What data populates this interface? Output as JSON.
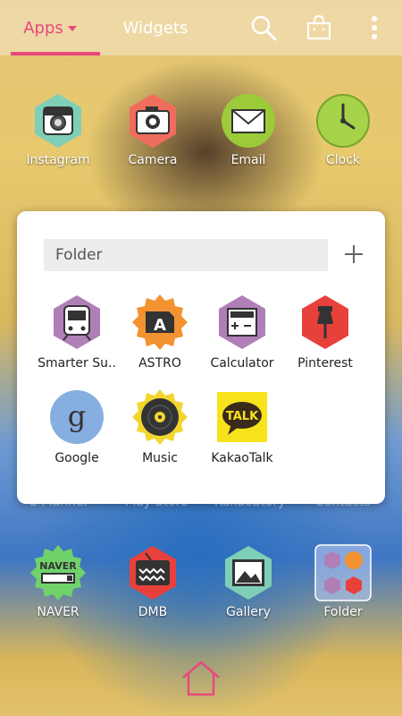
{
  "header": {
    "tabs": [
      {
        "label": "Apps",
        "active": true
      },
      {
        "label": "Widgets",
        "active": false
      }
    ],
    "icons": [
      "search-icon",
      "store-bag-icon",
      "more-options-icon"
    ],
    "accent_color": "#e8487b"
  },
  "apps_row1": [
    {
      "label": "Instagram",
      "icon": "instagram-icon"
    },
    {
      "label": "Camera",
      "icon": "camera-icon"
    },
    {
      "label": "Email",
      "icon": "email-icon"
    },
    {
      "label": "Clock",
      "icon": "clock-icon"
    }
  ],
  "hidden_row": [
    {
      "label": "S Planner"
    },
    {
      "label": "Play Store"
    },
    {
      "label": "KakaoStory"
    },
    {
      "label": "Contacts"
    }
  ],
  "folder": {
    "name_placeholder": "Folder",
    "add_icon": "plus-icon",
    "apps": [
      {
        "label": "Smarter Su..",
        "icon": "subway-icon"
      },
      {
        "label": "ASTRO",
        "icon": "astro-icon"
      },
      {
        "label": "Calculator",
        "icon": "calculator-icon"
      },
      {
        "label": "Pinterest",
        "icon": "pushpin-icon"
      },
      {
        "label": "Google",
        "icon": "google-icon"
      },
      {
        "label": "Music",
        "icon": "music-record-icon"
      },
      {
        "label": "KakaoTalk",
        "icon": "kakaotalk-icon"
      }
    ]
  },
  "dock": [
    {
      "label": "NAVER",
      "icon": "naver-icon",
      "badge": "NAVER"
    },
    {
      "label": "DMB",
      "icon": "tv-icon"
    },
    {
      "label": "Gallery",
      "icon": "gallery-icon"
    },
    {
      "label": "Folder",
      "icon": "folder-icon"
    }
  ],
  "nav": {
    "home_icon": "home-icon"
  },
  "icon_text": {
    "kakao": "TALK",
    "google": "g",
    "astro": "A"
  }
}
